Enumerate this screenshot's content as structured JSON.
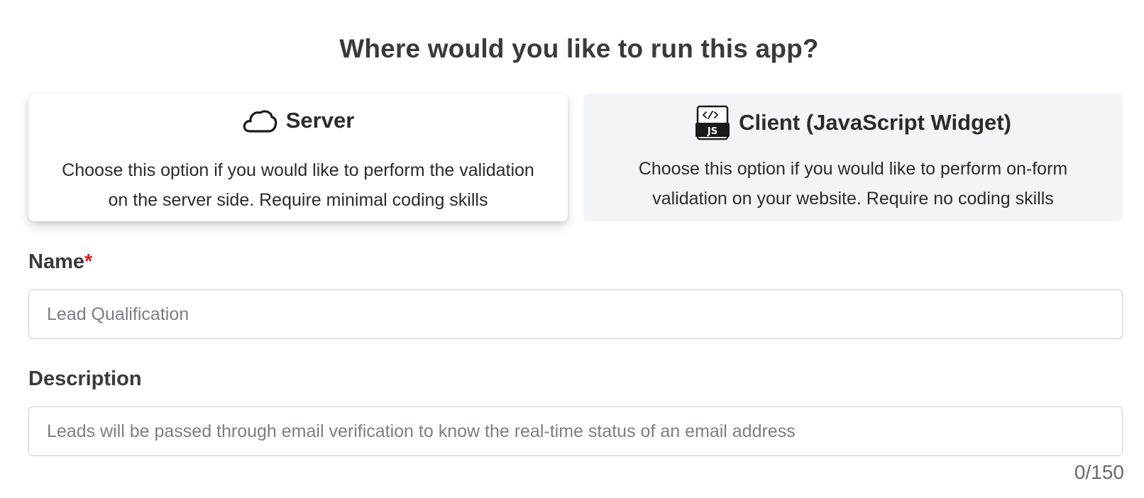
{
  "heading": "Where would you like to run this app?",
  "options": {
    "server": {
      "icon": "cloud-icon",
      "title": "Server",
      "description_line1": "Choose this option if you would like to perform the validation",
      "description_line2": "on the server side. Require minimal coding skills",
      "selected": true
    },
    "client": {
      "icon": "javascript-code-icon",
      "title": "Client (JavaScript Widget)",
      "description_line1": "Choose this option if you would like to perform on-form",
      "description_line2": "validation on your website. Require no coding skills",
      "selected": false
    }
  },
  "fields": {
    "name": {
      "label": "Name",
      "required_marker": "*",
      "value": "",
      "placeholder": "Lead Qualification"
    },
    "description": {
      "label": "Description",
      "value": "",
      "placeholder": "Leads will be passed through email verification to know the real-time status of an email address",
      "counter": "0/150"
    }
  },
  "colors": {
    "required": "#e02020",
    "selected_card_bg": "#ffffff",
    "unselected_card_bg": "#f3f4f8",
    "input_border": "#c9ccd1"
  }
}
